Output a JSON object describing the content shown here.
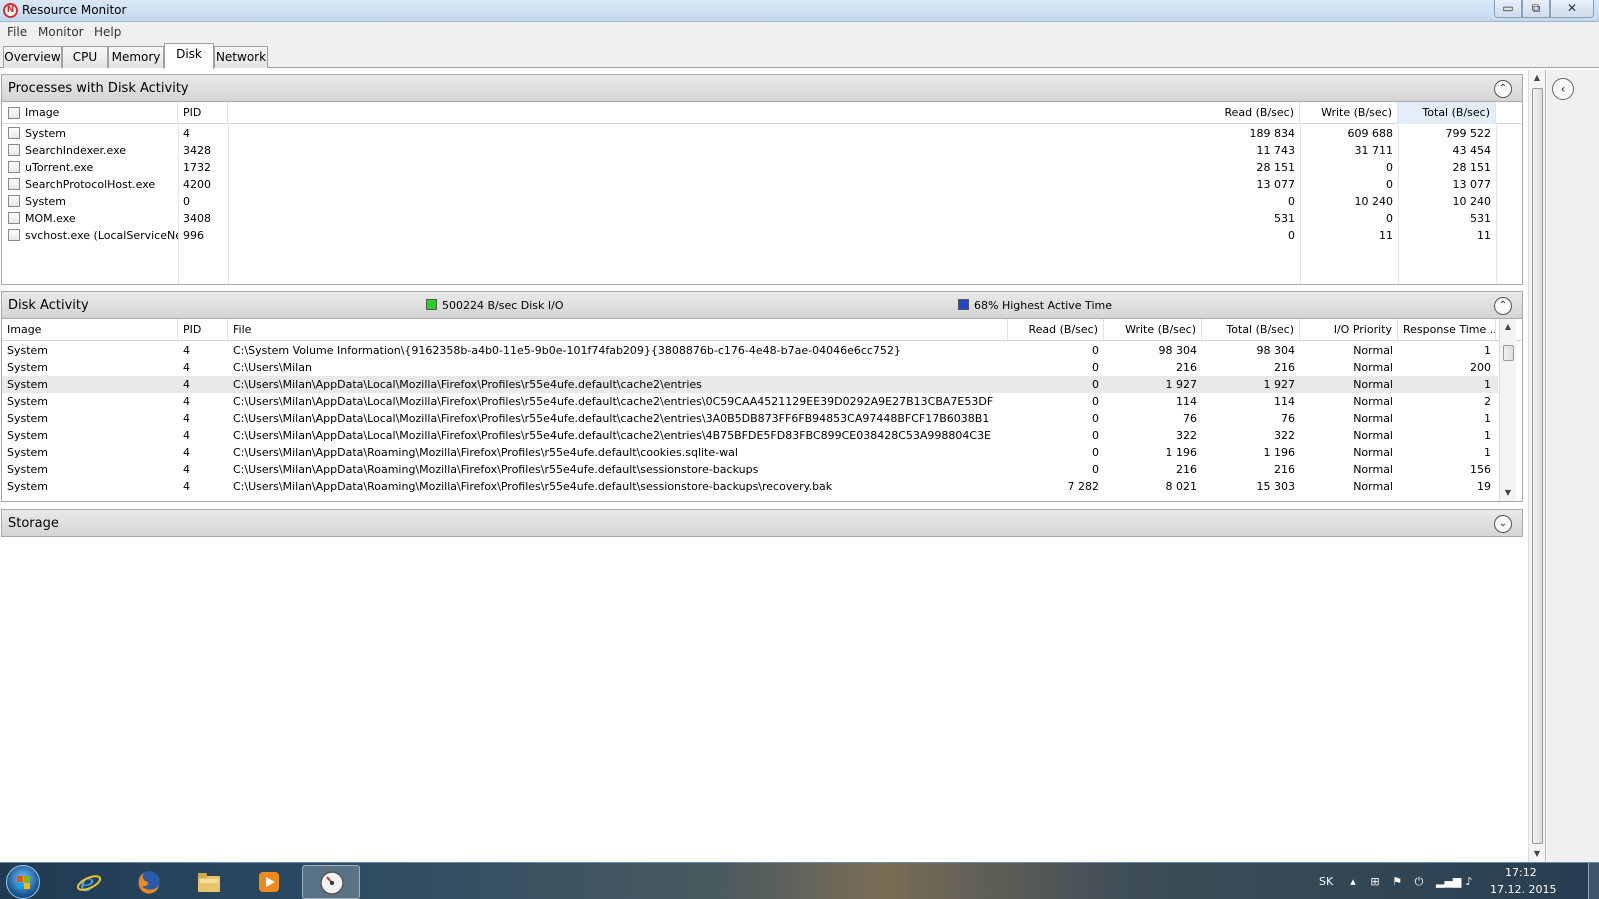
{
  "window": {
    "title": "Resource Monitor",
    "min_glyph": "▭",
    "max_glyph": "⧉",
    "close_glyph": "✕"
  },
  "menu": [
    "File",
    "Monitor",
    "Help"
  ],
  "tabs": [
    {
      "label": "Overview",
      "active": false
    },
    {
      "label": "CPU",
      "active": false
    },
    {
      "label": "Memory",
      "active": false
    },
    {
      "label": "Disk",
      "active": true
    },
    {
      "label": "Network",
      "active": false
    }
  ],
  "processes": {
    "title": "Processes with Disk Activity",
    "collapse_glyph": "⌃",
    "columns": [
      "Image",
      "PID",
      "Read (B/sec)",
      "Write (B/sec)",
      "Total (B/sec)"
    ],
    "rows": [
      [
        "System",
        "4",
        "189 834",
        "609 688",
        "799 522"
      ],
      [
        "SearchIndexer.exe",
        "3428",
        "11 743",
        "31 711",
        "43 454"
      ],
      [
        "uTorrent.exe",
        "1732",
        "28 151",
        "0",
        "28 151"
      ],
      [
        "SearchProtocolHost.exe",
        "4200",
        "13 077",
        "0",
        "13 077"
      ],
      [
        "System",
        "0",
        "0",
        "10 240",
        "10 240"
      ],
      [
        "MOM.exe",
        "3408",
        "531",
        "0",
        "531"
      ],
      [
        "svchost.exe (LocalServiceNet...",
        "996",
        "0",
        "11",
        "11"
      ]
    ]
  },
  "disk_activity": {
    "title": "Disk Activity",
    "io_label": "500224 B/sec Disk I/O",
    "active_label": "68% Highest Active Time",
    "io_color": "#22d322",
    "active_color": "#2248c8",
    "collapse_glyph": "⌃",
    "columns": [
      "Image",
      "PID",
      "File",
      "Read (B/sec)",
      "Write (B/sec)",
      "Total (B/sec)",
      "I/O Priority",
      "Response Time ..."
    ],
    "rows": [
      [
        "System",
        "4",
        "C:\\System Volume Information\\{9162358b-a4b0-11e5-9b0e-101f74fab209}{3808876b-c176-4e48-b7ae-04046e6cc752}",
        "0",
        "98 304",
        "98 304",
        "Normal",
        "1"
      ],
      [
        "System",
        "4",
        "C:\\Users\\Milan",
        "0",
        "216",
        "216",
        "Normal",
        "200"
      ],
      [
        "System",
        "4",
        "C:\\Users\\Milan\\AppData\\Local\\Mozilla\\Firefox\\Profiles\\r55e4ufe.default\\cache2\\entries",
        "0",
        "1 927",
        "1 927",
        "Normal",
        "1"
      ],
      [
        "System",
        "4",
        "C:\\Users\\Milan\\AppData\\Local\\Mozilla\\Firefox\\Profiles\\r55e4ufe.default\\cache2\\entries\\0C59CAA4521129EE39D0292A9E27B13CBA7E53DF",
        "0",
        "114",
        "114",
        "Normal",
        "2"
      ],
      [
        "System",
        "4",
        "C:\\Users\\Milan\\AppData\\Local\\Mozilla\\Firefox\\Profiles\\r55e4ufe.default\\cache2\\entries\\3A0B5DB873FF6FB94853CA97448BFCF17B6038B1",
        "0",
        "76",
        "76",
        "Normal",
        "1"
      ],
      [
        "System",
        "4",
        "C:\\Users\\Milan\\AppData\\Local\\Mozilla\\Firefox\\Profiles\\r55e4ufe.default\\cache2\\entries\\4B75BFDE5FD83FBC899CE038428C53A998804C3E",
        "0",
        "322",
        "322",
        "Normal",
        "1"
      ],
      [
        "System",
        "4",
        "C:\\Users\\Milan\\AppData\\Roaming\\Mozilla\\Firefox\\Profiles\\r55e4ufe.default\\cookies.sqlite-wal",
        "0",
        "1 196",
        "1 196",
        "Normal",
        "1"
      ],
      [
        "System",
        "4",
        "C:\\Users\\Milan\\AppData\\Roaming\\Mozilla\\Firefox\\Profiles\\r55e4ufe.default\\sessionstore-backups",
        "0",
        "216",
        "216",
        "Normal",
        "156"
      ],
      [
        "System",
        "4",
        "C:\\Users\\Milan\\AppData\\Roaming\\Mozilla\\Firefox\\Profiles\\r55e4ufe.default\\sessionstore-backups\\recovery.bak",
        "7 282",
        "8 021",
        "15 303",
        "Normal",
        "19"
      ]
    ],
    "selected_row": 2
  },
  "storage": {
    "title": "Storage",
    "expand_glyph": "⌄"
  },
  "side_pane": {
    "toggle_glyph": "‹"
  },
  "taskbar": {
    "language": "SK",
    "time": "17:12",
    "date": "17.12. 2015",
    "apps": [
      "internet-explorer",
      "firefox",
      "file-explorer",
      "media-player",
      "resource-monitor"
    ],
    "active_app": "resource-monitor"
  }
}
